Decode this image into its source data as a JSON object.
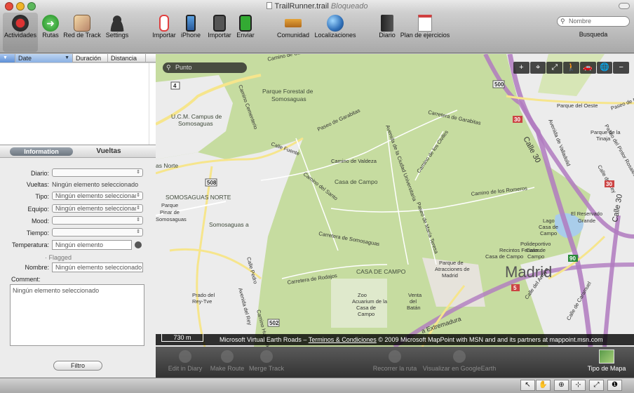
{
  "window": {
    "title": "TrailRunner.trail",
    "subtitle": "Bloqueado"
  },
  "toolbar": {
    "items": [
      "Actividades",
      "Rutas",
      "Red de Track",
      "Settings",
      "Importar",
      "iPhone",
      "Importar",
      "Enviar",
      "Comunidad",
      "Localizaciones",
      "Diario",
      "Plan de ejercicios"
    ],
    "search_placeholder": "Nombre",
    "search_label": "Busqueda"
  },
  "list": {
    "columns": [
      "Date",
      "Duración",
      "Distancia"
    ]
  },
  "info": {
    "tabs": [
      "Information",
      "Vueltas"
    ],
    "labels": {
      "diario": "Diario:",
      "vueltas": "Vueltas:",
      "tipo": "Tipo:",
      "equipo": "Equipo:",
      "mood": "Mood:",
      "tiempo": "Tiempo:",
      "temperatura": "Temperatura:",
      "flagged": "Flagged",
      "nombre": "Nombre:",
      "comment": "Comment:"
    },
    "values": {
      "vueltas": "Ningún elemento seleccionado",
      "tipo": "Ningún elemento seleccionad",
      "equipo": "Ningún elemento seleccionad",
      "temperatura": "Ningún elemento",
      "nombre": "Ningún elemento seleccionado",
      "comment": "Ningún elemento seleccionado"
    },
    "filter_button": "Filtro"
  },
  "map": {
    "search_placeholder": "Punto",
    "controls": [
      "+",
      "⌖",
      "⤢",
      "🚶",
      "🚗",
      "🌐",
      "−"
    ],
    "scale": "730 m",
    "attribution_prefix": "Microsoft Virtual Earth Roads –",
    "attribution_link": "Terminos & Condiciones",
    "attribution_suffix": "© 2009 Microsoft MapPoint with MSN and and its partners at mappoint.msn.com",
    "labels": {
      "parque_forestal": "Parque Forestal de",
      "somosaguas": "Somosaguas",
      "ucm1": "U.C.M. Campus de",
      "ucm2": "Somosaguas",
      "camino_cementerio": "Camino Cementerio",
      "paseo_garabitas": "Paseo de Garabitas",
      "carretera_garabitas": "Carretera de Garabitas",
      "camino_castilla": "Camino de Castilla",
      "calle_fuente": "Calle Fuente",
      "camino_valdeza": "Camino de Valdeza",
      "casa_campo": "Casa de Campo",
      "camino_santo": "Camino del Santo",
      "av_ciudad_univ": "Avenida de la Ciudad Universitaria",
      "camino_civiles": "Camino de los Civiles",
      "camino_romeros": "Camino de los Romeros",
      "paseo_teresa": "Paseo de María Teresa",
      "carretera_somosaguas": "Carretera de Somosaguas",
      "casa_campo_caps": "CASA DE CAMPO",
      "carretera_rodajos": "Carretera de Rodajos",
      "zoo1": "Zoo",
      "zoo2": "Acuarium de la",
      "zoo3": "Casa de",
      "zoo4": "Campo",
      "venta1": "Venta",
      "venta2": "del",
      "venta3": "Batán",
      "parque_atr1": "Parque de",
      "parque_atr2": "Atracciones de",
      "parque_atr3": "Madrid",
      "somosaguas_norte": "SOMOSAGUAS NORTE",
      "somosaguas_norte2": "as Norte",
      "somosaguas_a": "Somosaguas a",
      "parque_pinar1": "Parque",
      "parque_pinar2": "Pinar de",
      "parque_pinar3": "Somosaguas",
      "prado_rey1": "Prado del",
      "prado_rey2": "Rey-Tve",
      "calle_pedro": "Calle Pedro",
      "av_rey": "Avenida del Rey",
      "lago1": "Lago",
      "lago2": "Casa de",
      "lago3": "Campo",
      "recintos1": "Recintos Feriales",
      "recintos2": "Casa de Campo",
      "polideportivo1": "Polideportivo",
      "polideportivo2": "Casa de",
      "polideportivo3": "Campo",
      "madrid": "Madrid",
      "parque_oeste": "Parque del Oeste",
      "parque_tinaja1": "Parque de la",
      "parque_tinaja2": "Tinaja",
      "av_valladolid": "Avenida de Valladolid",
      "paseo_moret": "Paseo de Moret",
      "paseo_pintor": "Paseo del Pintor Rosales",
      "calle_rey": "Calle del Rey",
      "reservado1": "El Reservado",
      "reservado2": "Grande",
      "calle30a": "Calle 30",
      "calle30b": "Calle 30",
      "calle_caramuel": "Calle de Caramuel",
      "extremadura": "a Extremadura",
      "ghumera": "Camino Humera",
      "calle_arr": "Calle del Arroyo",
      "r500": "500",
      "r30": "30",
      "r508": "508",
      "r90": "90",
      "r5": "5",
      "r4": "4",
      "r502": "502",
      "r30b": "30"
    },
    "map_type_label": "Tipo de Mapa"
  },
  "bottom_tools": [
    "Edit in Diary",
    "Make Route",
    "Merge Track",
    "Recorrer la ruta",
    "Visualizar en GoogleEarth"
  ],
  "status_tools": [
    "↖",
    "✋",
    "⊕",
    "⊹",
    "⤢",
    "❶"
  ],
  "colors": {
    "park": "#c6dca0",
    "urban": "#ececec",
    "highway": "#b07ac0",
    "road": "#f6e58c"
  }
}
